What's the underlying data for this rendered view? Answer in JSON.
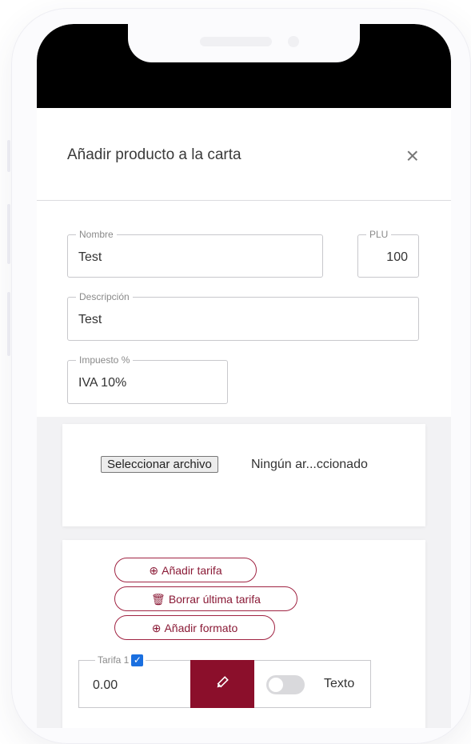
{
  "modal": {
    "title": "Añadir producto a la carta",
    "close_glyph": "×"
  },
  "fields": {
    "nombre": {
      "label": "Nombre",
      "value": "Test"
    },
    "plu": {
      "label": "PLU",
      "value": "100"
    },
    "descripcion": {
      "label": "Descripción",
      "value": "Test"
    },
    "impuesto": {
      "label": "Impuesto %",
      "value": "IVA 10%"
    }
  },
  "file_upload": {
    "button_label": "Seleccionar archivo",
    "status_text": "Ningún ar...ccionado"
  },
  "tarifas": {
    "add_tarifa_label": "Añadir tarifa",
    "delete_last_label": "Borrar última tarifa",
    "add_format_label": "Añadir formato",
    "tarifa1": {
      "label": "Tarifa 1",
      "checked": true,
      "value": "0.00"
    },
    "toggle_label": "Texto"
  },
  "colors": {
    "accent": "#8b0f2b",
    "checkbox": "#1a6fe0"
  },
  "icons": {
    "close": "close-icon",
    "add": "plus-circle-icon",
    "delete": "trash-icon",
    "edit": "pencil-icon"
  }
}
